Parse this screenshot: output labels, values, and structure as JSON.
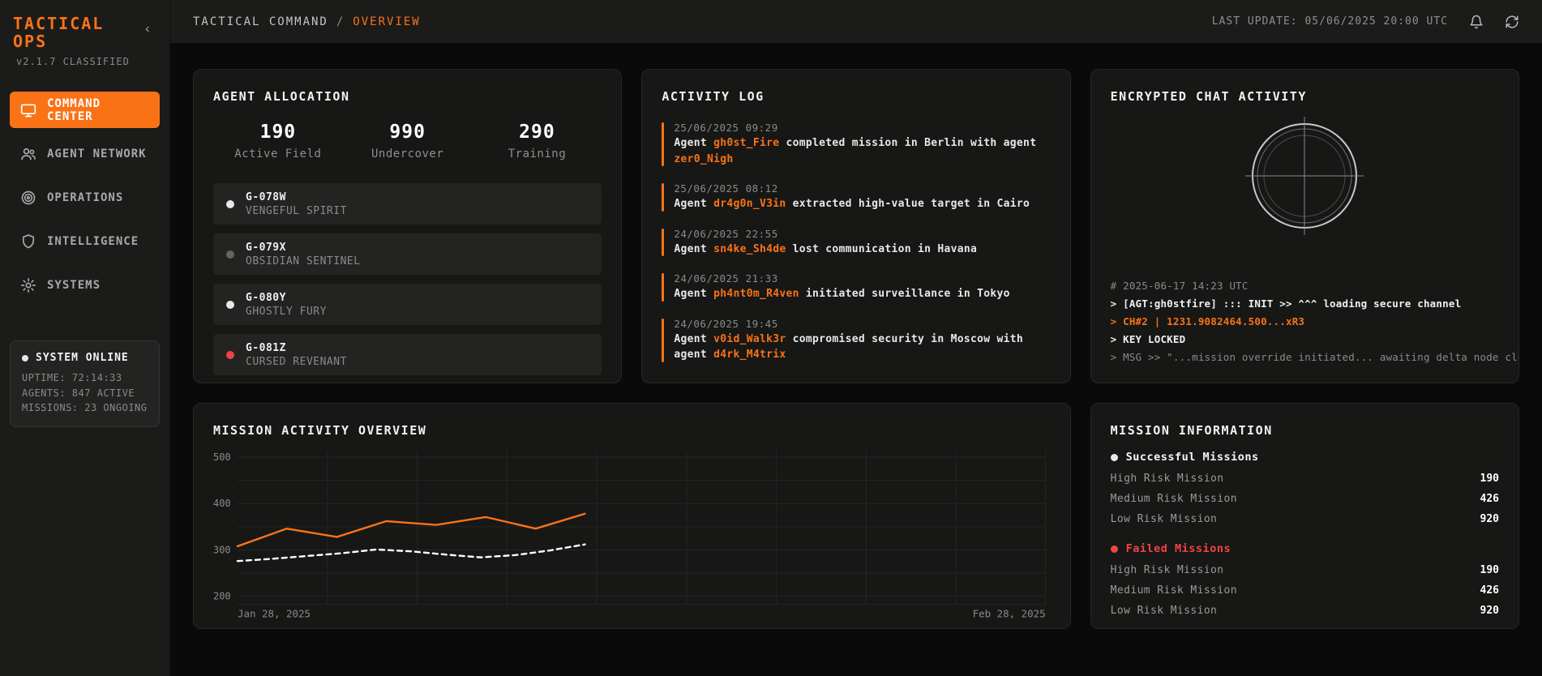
{
  "app": {
    "title": "TACTICAL OPS",
    "version": "v2.1.7 CLASSIFIED",
    "collapse_icon": "chevron-left-icon",
    "collapse_glyph": "‹"
  },
  "colors": {
    "accent": "#f97316",
    "danger": "#ef4444",
    "grid": "#262626",
    "muted": "#8a8a8a"
  },
  "sidebar": {
    "items": [
      {
        "label": "COMMAND CENTER",
        "icon": "monitor-icon",
        "active": true
      },
      {
        "label": "AGENT NETWORK",
        "icon": "users-icon",
        "active": false
      },
      {
        "label": "OPERATIONS",
        "icon": "target-icon",
        "active": false
      },
      {
        "label": "INTELLIGENCE",
        "icon": "shield-icon",
        "active": false
      },
      {
        "label": "SYSTEMS",
        "icon": "gear-icon",
        "active": false
      }
    ],
    "status": {
      "title": "SYSTEM ONLINE",
      "lines": [
        "UPTIME: 72:14:33",
        "AGENTS: 847 ACTIVE",
        "MISSIONS: 23 ONGOING"
      ]
    }
  },
  "header": {
    "breadcrumb_root": "TACTICAL COMMAND",
    "breadcrumb_sep": "/",
    "breadcrumb_current": "OVERVIEW",
    "last_update": "LAST UPDATE: 05/06/2025 20:00 UTC",
    "bell_icon": "bell-icon",
    "refresh_icon": "refresh-icon"
  },
  "agent_allocation": {
    "title": "AGENT ALLOCATION",
    "stats": [
      {
        "value": "190",
        "label": "Active Field"
      },
      {
        "value": "990",
        "label": "Undercover"
      },
      {
        "value": "290",
        "label": "Training"
      }
    ],
    "agents": [
      {
        "id": "G-078W",
        "codename": "VENGEFUL SPIRIT",
        "status": "active"
      },
      {
        "id": "G-079X",
        "codename": "OBSIDIAN SENTINEL",
        "status": "idle"
      },
      {
        "id": "G-080Y",
        "codename": "GHOSTLY FURY",
        "status": "active"
      },
      {
        "id": "G-081Z",
        "codename": "CURSED REVENANT",
        "status": "alert"
      }
    ]
  },
  "activity_log": {
    "title": "ACTIVITY LOG",
    "entries": [
      {
        "timestamp": "25/06/2025 09:29",
        "parts": [
          {
            "t": "Agent "
          },
          {
            "t": "gh0st_Fire",
            "agent": true
          },
          {
            "t": " completed mission in Berlin with agent "
          },
          {
            "t": "zer0_Nigh",
            "agent": true
          }
        ]
      },
      {
        "timestamp": "25/06/2025 08:12",
        "parts": [
          {
            "t": "Agent "
          },
          {
            "t": "dr4g0n_V3in",
            "agent": true
          },
          {
            "t": " extracted high-value target in Cairo"
          }
        ]
      },
      {
        "timestamp": "24/06/2025 22:55",
        "parts": [
          {
            "t": "Agent "
          },
          {
            "t": "sn4ke_Sh4de",
            "agent": true
          },
          {
            "t": " lost communication in Havana"
          }
        ]
      },
      {
        "timestamp": "24/06/2025 21:33",
        "parts": [
          {
            "t": "Agent "
          },
          {
            "t": "ph4nt0m_R4ven",
            "agent": true
          },
          {
            "t": " initiated surveillance in Tokyo"
          }
        ]
      },
      {
        "timestamp": "24/06/2025 19:45",
        "parts": [
          {
            "t": "Agent "
          },
          {
            "t": "v0id_Walk3r",
            "agent": true
          },
          {
            "t": " compromised security in Moscow with agent "
          },
          {
            "t": "d4rk_M4trix",
            "agent": true
          }
        ]
      }
    ]
  },
  "encrypted_chat": {
    "title": "ENCRYPTED CHAT ACTIVITY",
    "radar": "radar-scope-icon",
    "terminal": [
      {
        "text": "# 2025-06-17 14:23 UTC",
        "style": "muted"
      },
      {
        "text": "> [AGT:gh0stfire] ::: INIT >> ^^^ loading secure channel",
        "style": "bright"
      },
      {
        "text": "> CH#2 | 1231.9082464.500...xR3",
        "style": "accent"
      },
      {
        "text": "> KEY LOCKED",
        "style": "bright"
      },
      {
        "text": "> MSG >> \"...mission override initiated... awaiting delta node clearance\"",
        "style": "muted"
      }
    ]
  },
  "chart_data": {
    "type": "line",
    "title": "MISSION ACTIVITY OVERVIEW",
    "xlabel": "",
    "ylabel": "",
    "x_axis_range": [
      "Jan 28, 2025",
      "Feb 28, 2025"
    ],
    "x_start_label": "Jan 28, 2025",
    "x_end_label": "Feb 28, 2025",
    "ylim": [
      200,
      500
    ],
    "y_ticks": [
      200,
      300,
      400,
      500
    ],
    "grid_y_step": 50,
    "x_grid_divisions": 9,
    "grid": true,
    "legend_position": "none",
    "note": "data series span Jan 28 - Feb 10 (left 43% of axis)",
    "series": [
      {
        "name": "solid-orange",
        "color": "#f97316",
        "dash": false,
        "x_frac": [
          0.0,
          0.061,
          0.123,
          0.184,
          0.246,
          0.307,
          0.369,
          0.43
        ],
        "values": [
          308,
          346,
          328,
          362,
          354,
          371,
          346,
          378
        ]
      },
      {
        "name": "dashed-white",
        "color": "#ffffff",
        "dash": true,
        "x_frac": [
          0.0,
          0.043,
          0.086,
          0.129,
          0.172,
          0.215,
          0.258,
          0.301,
          0.344,
          0.387,
          0.43
        ],
        "values": [
          276,
          281,
          287,
          293,
          301,
          297,
          290,
          284,
          289,
          299,
          312
        ]
      }
    ]
  },
  "mission_info": {
    "title": "MISSION INFORMATION",
    "sections": [
      {
        "label": "Successful Missions",
        "status": "success",
        "rows": [
          [
            "High Risk Mission",
            "190"
          ],
          [
            "Medium Risk Mission",
            "426"
          ],
          [
            "Low Risk Mission",
            "920"
          ]
        ]
      },
      {
        "label": "Failed Missions",
        "status": "failed",
        "rows": [
          [
            "High Risk Mission",
            "190"
          ],
          [
            "Medium Risk Mission",
            "426"
          ],
          [
            "Low Risk Mission",
            "920"
          ]
        ]
      }
    ]
  }
}
